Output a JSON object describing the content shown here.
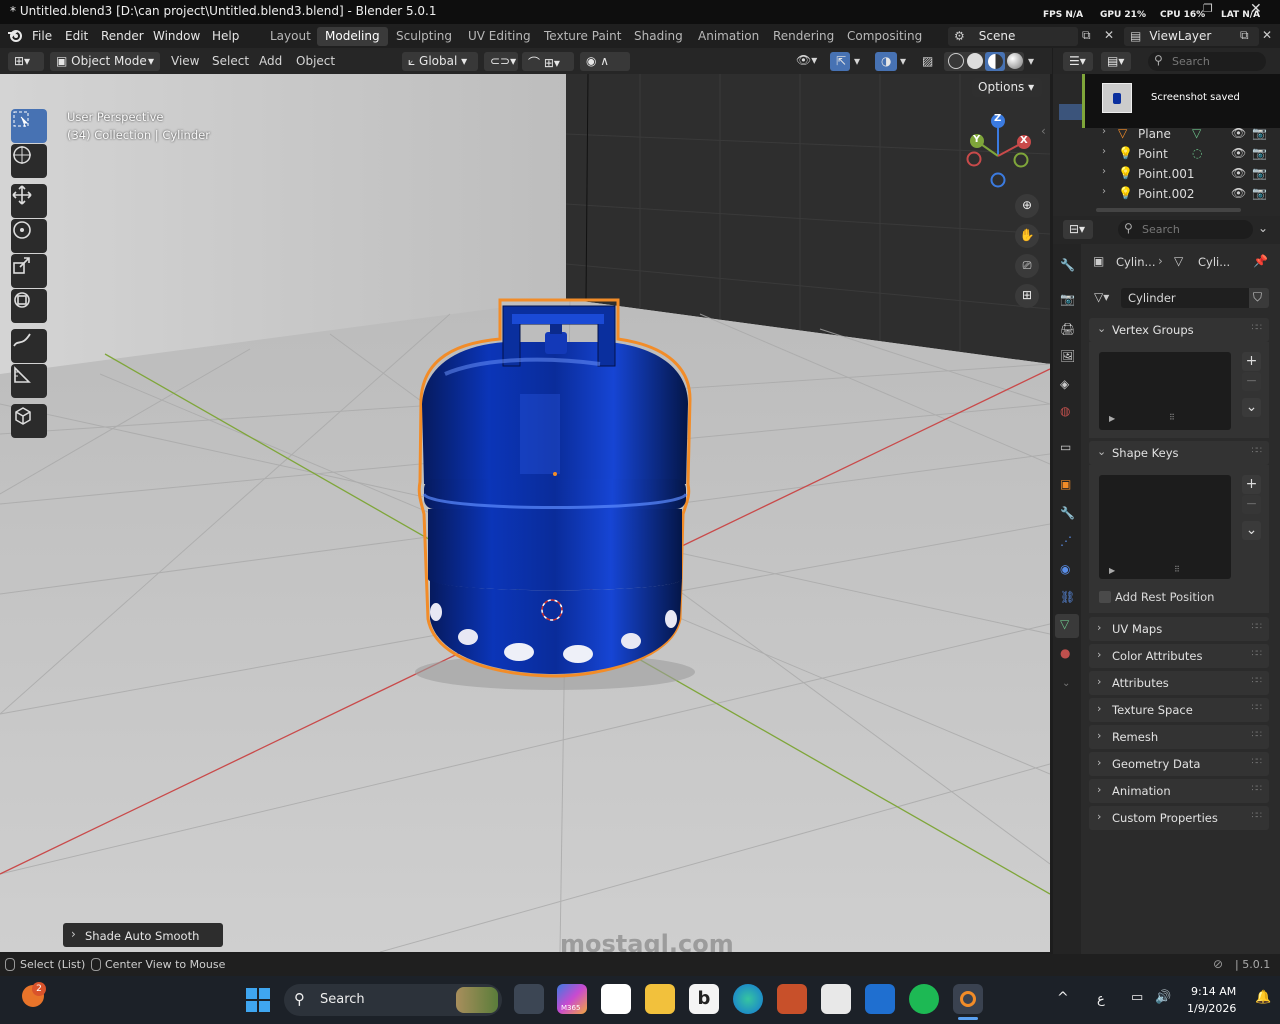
{
  "window": {
    "title": "* Untitled.blend3 [D:\\can project\\Untitled.blend3.blend] - Blender 5.0.1",
    "stats": {
      "fps": "FPS N/A",
      "gpu": "GPU 21%",
      "cpu": "CPU 16%",
      "lat": "LAT N/A"
    }
  },
  "menu": [
    "File",
    "Edit",
    "Render",
    "Window",
    "Help"
  ],
  "workspaces": [
    "Layout",
    "Modeling",
    "Sculpting",
    "UV Editing",
    "Texture Paint",
    "Shading",
    "Animation",
    "Rendering",
    "Compositing"
  ],
  "active_workspace": "Modeling",
  "scene": {
    "name": "Scene",
    "view_layer": "ViewLayer"
  },
  "viewport_header": {
    "mode": "Object Mode",
    "menus": [
      "View",
      "Select",
      "Add",
      "Object"
    ],
    "orientation": "Global",
    "options": "Options"
  },
  "viewport": {
    "perspective": "User Perspective",
    "collection_info": "(34) Collection | Cylinder",
    "gizmo_axes": [
      "Z",
      "Y",
      "X"
    ],
    "operator_panel": "Shade Auto Smooth",
    "watermark": "mostaql.com"
  },
  "outliner": {
    "search_placeholder": "Search",
    "notification": "Screenshot saved",
    "items": [
      {
        "name": "Plane",
        "icon": "mesh-icon"
      },
      {
        "name": "Point",
        "icon": "light-icon"
      },
      {
        "name": "Point.001",
        "icon": "light-icon"
      },
      {
        "name": "Point.002",
        "icon": "light-icon"
      }
    ]
  },
  "properties": {
    "search_placeholder": "Search",
    "breadcrumb": [
      "Cylin...",
      "Cyli..."
    ],
    "data_name": "Cylinder",
    "panels_open": [
      "Vertex Groups",
      "Shape Keys"
    ],
    "add_rest_position": "Add Rest Position",
    "panels_closed": [
      "UV Maps",
      "Color Attributes",
      "Attributes",
      "Texture Space",
      "Remesh",
      "Geometry Data",
      "Animation",
      "Custom Properties"
    ]
  },
  "statusbar": {
    "left_hints": [
      "Select (List)",
      "Center View to Mouse"
    ],
    "version": "5.0.1"
  },
  "taskbar": {
    "search_label": "Search",
    "notification_count": "2",
    "time": "9:14 AM",
    "date": "1/9/2026",
    "language": "ع",
    "m365_label": "M365"
  },
  "colors": {
    "accent_blue": "#4772b3",
    "selection_orange": "#f28c28",
    "object_blue": "#0a2f9e",
    "x_axis": "#c94a4a",
    "y_axis": "#7fa63a",
    "z_axis": "#3b7be0"
  }
}
